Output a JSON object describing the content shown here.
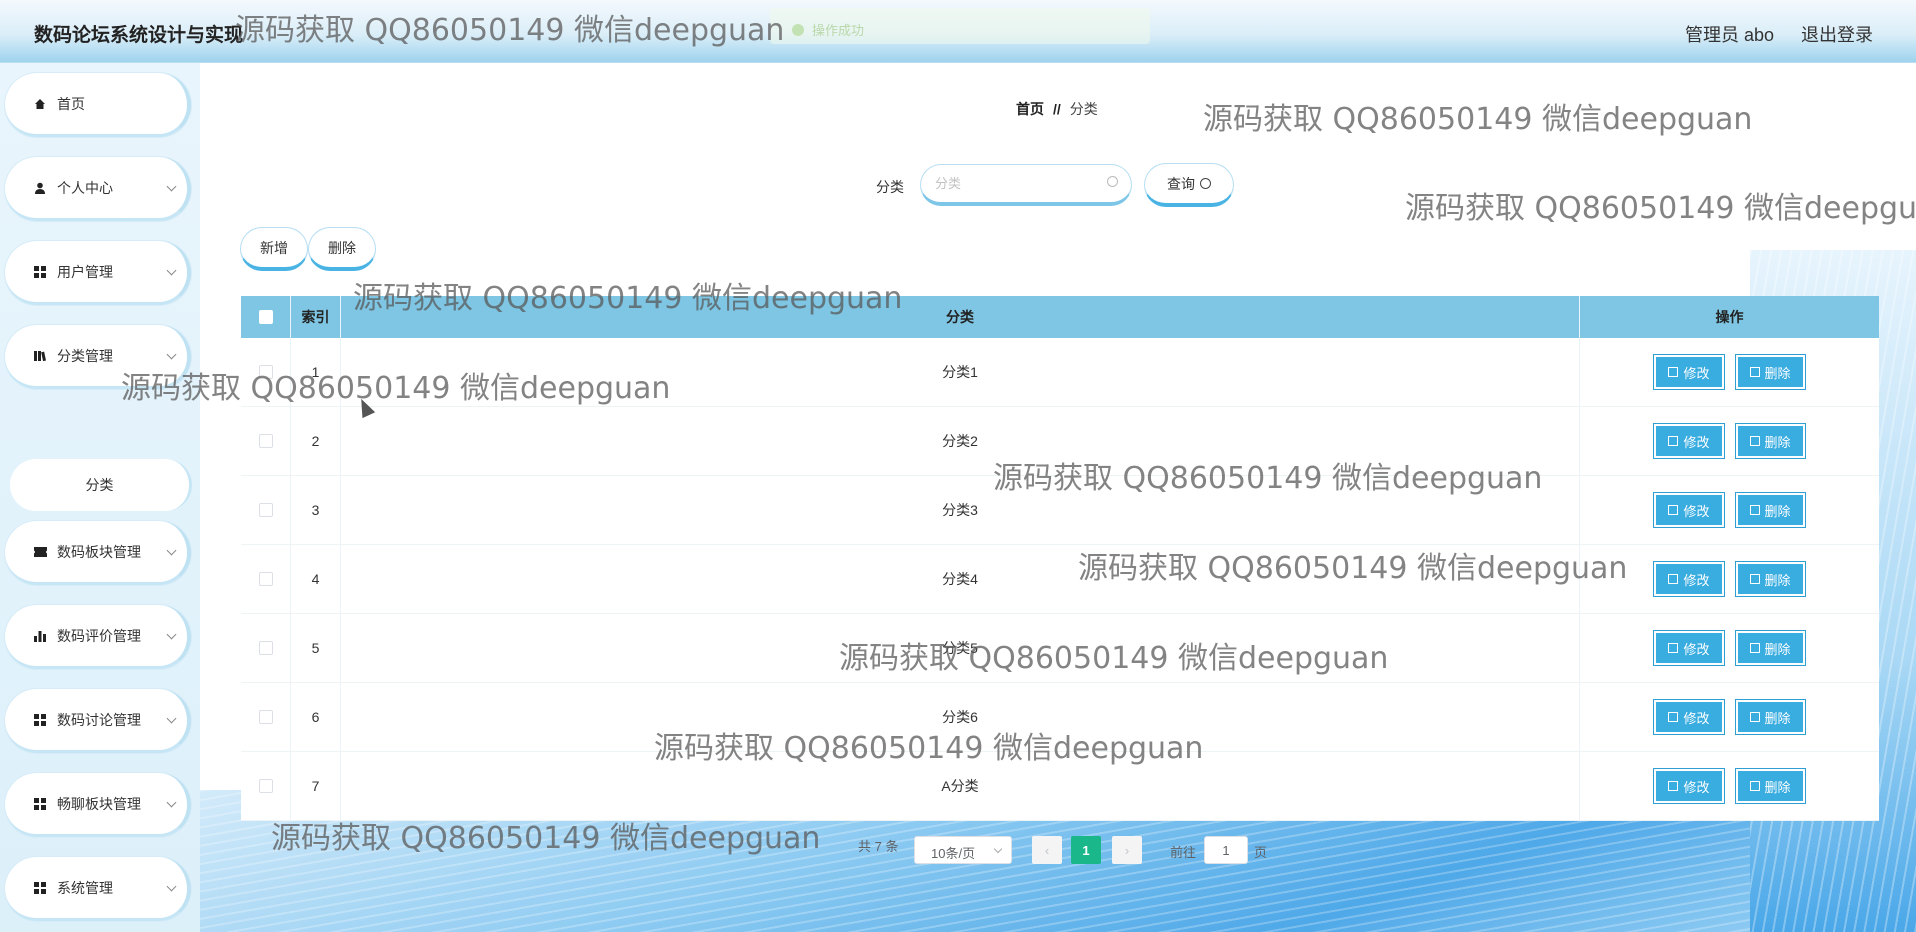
{
  "header": {
    "app_title": "数码论坛系统设计与实现",
    "admin_label": "管理员 abo",
    "logout_label": "退出登录",
    "toast_text": "操作成功"
  },
  "sidebar": {
    "items": [
      {
        "label": "首页",
        "icon": "home-icon"
      },
      {
        "label": "个人中心",
        "icon": "user-icon"
      },
      {
        "label": "用户管理",
        "icon": "grid-icon"
      },
      {
        "label": "分类管理",
        "icon": "book-icon"
      },
      {
        "label": "数码板块管理",
        "icon": "ticket-icon"
      },
      {
        "label": "数码评价管理",
        "icon": "bar-chart-icon"
      },
      {
        "label": "数码讨论管理",
        "icon": "grid-icon"
      },
      {
        "label": "畅聊板块管理",
        "icon": "grid-icon"
      },
      {
        "label": "系统管理",
        "icon": "grid-icon"
      }
    ],
    "sub_item": "分类"
  },
  "breadcrumb": {
    "home": "首页",
    "separator": "//",
    "current": "分类"
  },
  "search": {
    "label": "分类",
    "placeholder": "分类",
    "query_label": "查询"
  },
  "toolbar": {
    "add_label": "新增",
    "delete_label": "删除"
  },
  "table": {
    "headers": {
      "index": "索引",
      "category": "分类",
      "operation": "操作"
    },
    "edit_label": "修改",
    "delete_label": "删除",
    "rows": [
      {
        "index": "1",
        "category": "分类1"
      },
      {
        "index": "2",
        "category": "分类2"
      },
      {
        "index": "3",
        "category": "分类3"
      },
      {
        "index": "4",
        "category": "分类4"
      },
      {
        "index": "5",
        "category": "分类5"
      },
      {
        "index": "6",
        "category": "分类6"
      },
      {
        "index": "7",
        "category": "A分类"
      }
    ]
  },
  "pagination": {
    "total": "共 7 条",
    "page_size": "10条/页",
    "current_page": "1",
    "goto_prefix": "前往",
    "goto_value": "1",
    "goto_suffix": "页"
  },
  "watermark": "源码获取 QQ86050149 微信deepguan",
  "colors": {
    "accent": "#39ace0",
    "header_bg": "#7ec6e4",
    "page_active": "#19b78a"
  }
}
